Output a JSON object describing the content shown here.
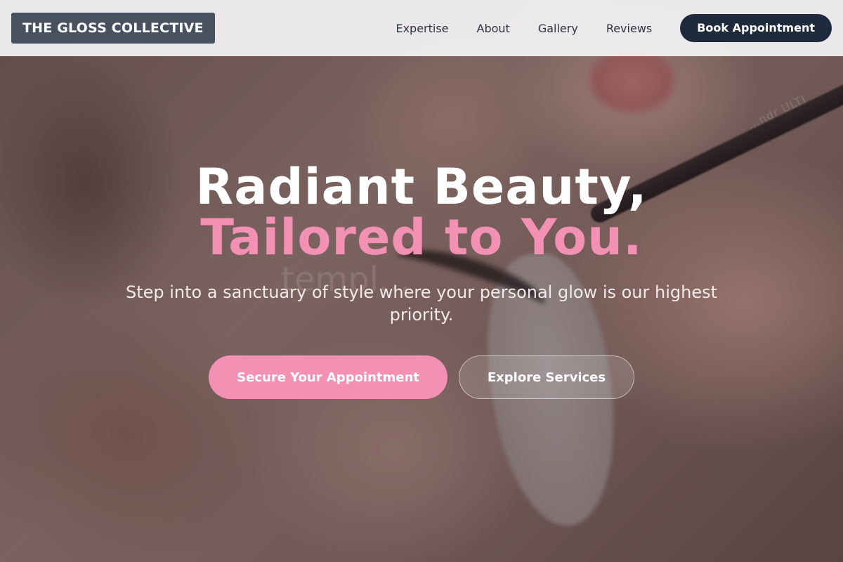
{
  "header": {
    "brand": "THE GLOSS COLLECTIVE",
    "nav": [
      "Expertise",
      "About",
      "Gallery",
      "Reviews"
    ],
    "cta_label": "Book Appointment"
  },
  "hero": {
    "headline_line1": "Radiant Beauty,",
    "headline_line2": "Tailored to You.",
    "subtext": "Step into a sanctuary of style where your personal glow is our highest priority.",
    "primary_cta": "Secure Your Appointment",
    "secondary_cta": "Explore Services",
    "watermark": "templ...",
    "product_text": "...ndr ULTI"
  },
  "colors": {
    "accent_pink": "#f291b4",
    "brand_bg": "#475160",
    "dark_button": "#1f2a3d",
    "header_bg": "#f3f3f5"
  },
  "image": {
    "icon": "lash-extension-photo"
  }
}
